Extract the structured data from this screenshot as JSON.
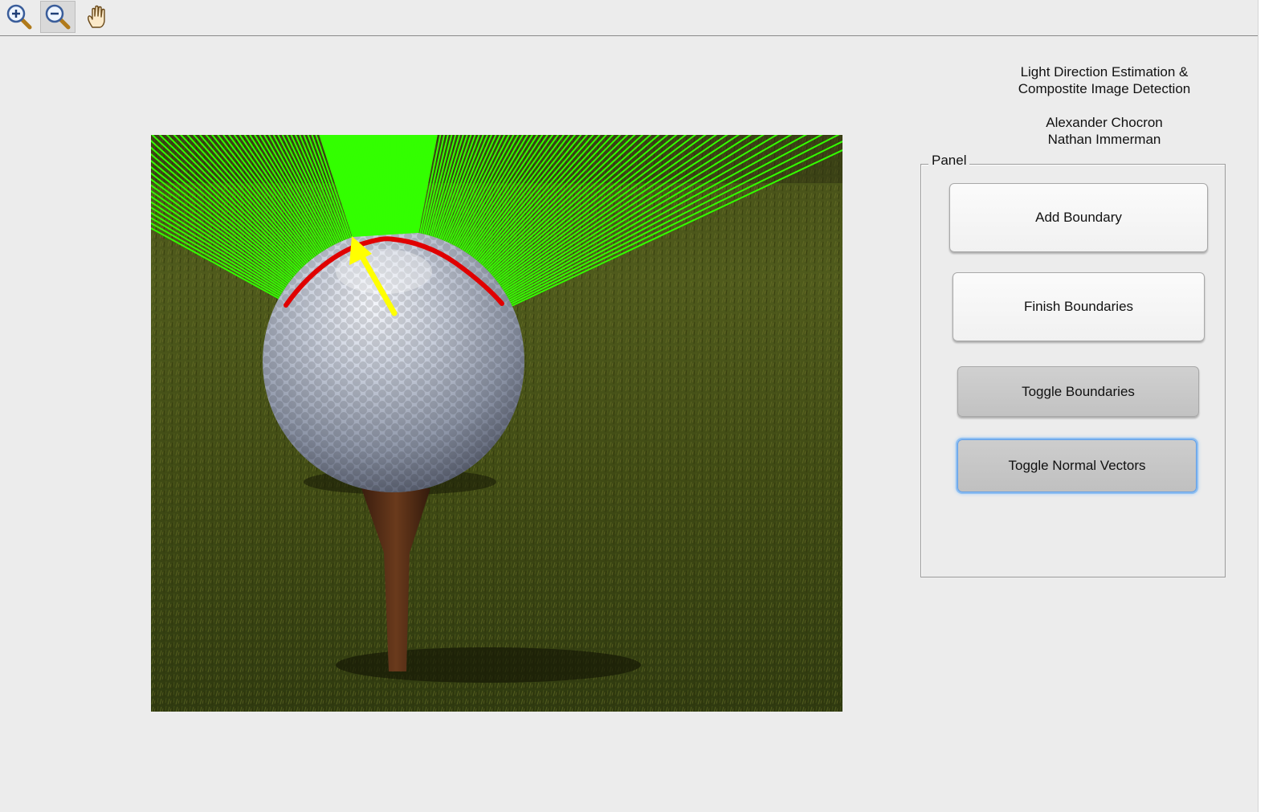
{
  "toolbar": {
    "tools": [
      {
        "name": "zoom-in-icon",
        "active": false
      },
      {
        "name": "zoom-out-icon",
        "active": true
      },
      {
        "name": "pan-hand-icon",
        "active": false
      }
    ]
  },
  "header": {
    "title_line1": "Light Direction Estimation &",
    "title_line2": "Compostite Image Detection",
    "author1": "Alexander Chocron",
    "author2": "Nathan Immerman"
  },
  "panel": {
    "title": "Panel",
    "buttons": {
      "add_boundary": "Add Boundary",
      "finish_boundaries": "Finish Boundaries",
      "toggle_boundaries": "Toggle Boundaries",
      "toggle_normal_vectors": "Toggle Normal Vectors"
    }
  },
  "image": {
    "subject": "golf ball on tee on grass",
    "overlays": {
      "boundary_color": "#e00000",
      "normals_color": "#33ff00",
      "light_arrow_color": "#ffff00"
    }
  }
}
